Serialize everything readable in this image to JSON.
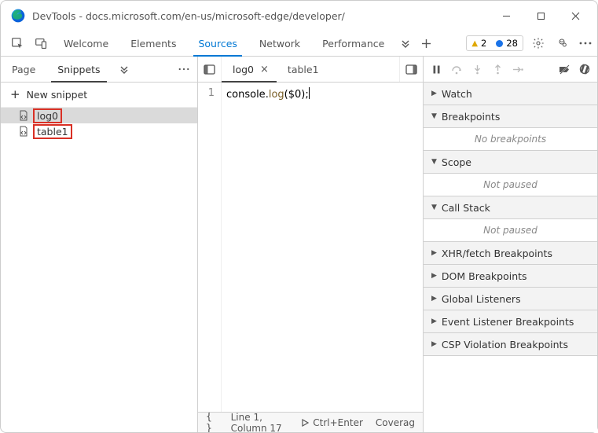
{
  "window": {
    "app": "DevTools",
    "title": "DevTools - docs.microsoft.com/en-us/microsoft-edge/developer/"
  },
  "main_tabs": {
    "items": [
      "Welcome",
      "Elements",
      "Sources",
      "Network",
      "Performance"
    ],
    "active": "Sources"
  },
  "issues": {
    "warnings": "2",
    "info": "28"
  },
  "navigator": {
    "tabs": [
      "Page",
      "Snippets"
    ],
    "active": "Snippets",
    "new_label": "New snippet",
    "snippets": [
      {
        "name": "log0",
        "selected": true,
        "highlight": true
      },
      {
        "name": "table1",
        "selected": false,
        "highlight": true
      }
    ]
  },
  "editor": {
    "tabs": [
      {
        "name": "log0",
        "active": true,
        "closeable": true
      },
      {
        "name": "table1",
        "active": false,
        "closeable": false
      }
    ],
    "gutter": "1",
    "code": {
      "p1": "console",
      "p2": ".",
      "p3": "log",
      "p4": "(",
      "p5": "$0",
      "p6": ");"
    }
  },
  "status": {
    "braces": "{ }",
    "position": "Line 1, Column 17",
    "run": "Ctrl+Enter",
    "coverage": "Coverag"
  },
  "debugger": {
    "sections": {
      "watch": {
        "label": "Watch",
        "open": false
      },
      "breakpoints": {
        "label": "Breakpoints",
        "open": true,
        "body": "No breakpoints"
      },
      "scope": {
        "label": "Scope",
        "open": true,
        "body": "Not paused"
      },
      "callstack": {
        "label": "Call Stack",
        "open": true,
        "body": "Not paused"
      },
      "xhr": {
        "label": "XHR/fetch Breakpoints",
        "open": false
      },
      "dom": {
        "label": "DOM Breakpoints",
        "open": false
      },
      "global": {
        "label": "Global Listeners",
        "open": false
      },
      "event": {
        "label": "Event Listener Breakpoints",
        "open": false
      },
      "csp": {
        "label": "CSP Violation Breakpoints",
        "open": false
      }
    }
  }
}
